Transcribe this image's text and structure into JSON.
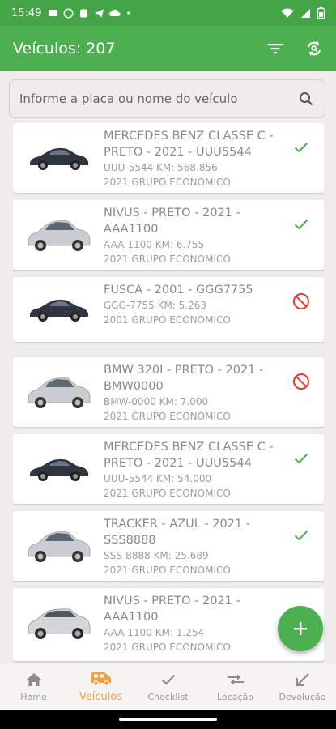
{
  "status_bar": {
    "time": "15:49",
    "dot": "•"
  },
  "header": {
    "title": "Veículos: 207"
  },
  "search": {
    "placeholder": "Informe a placa ou nome do veículo"
  },
  "colors": {
    "primary": "#4caf50",
    "accent": "#f0a040",
    "ok": "#4caf50",
    "blocked": "#e53935"
  },
  "vehicles": [
    {
      "name": "MERCEDES BENZ CLASSE C - PRETO  - 2021 - UUU5544",
      "info": "UUU-5544 KM: 568.856",
      "group": "2021 GRUPO ECONOMICO",
      "status": "check-icon",
      "image": "dark-sedan"
    },
    {
      "name": "NIVUS  - PRETO  - 2021 - AAA1100",
      "info": "AAA-1100 KM: 6.755",
      "group": "2021 GRUPO ECONOMICO",
      "status": "check-icon",
      "image": "silver-sedan"
    },
    {
      "name": "FUSCA  - 2001 - GGG7755",
      "info": "GGG-7755 KM: 5.263",
      "group": "2001 GRUPO ECONOMICO",
      "status": "blocked-icon",
      "image": "dark-sedan"
    },
    {
      "name": "BMW 320I - PRETO  - 2021 - BMW0000",
      "info": "BMW-0000 KM: 7.000",
      "group": "2021 GRUPO ECONOMICO",
      "status": "blocked-icon",
      "image": "silver-sedan"
    },
    {
      "name": "MERCEDES BENZ CLASSE C - PRETO  - 2021 - UUU5544",
      "info": "UUU-5544 KM: 54.000",
      "group": "2021 GRUPO ECONOMICO",
      "status": "check-icon",
      "image": "dark-sedan"
    },
    {
      "name": "TRACKER  - AZUL  - 2021 - SSS8888",
      "info": "SSS-8888 KM: 25.689",
      "group": "2021 GRUPO ECONOMICO",
      "status": "check-icon",
      "image": "silver-sedan"
    },
    {
      "name": "NIVUS  - PRETO  - 2021 - AAA1100",
      "info": "AAA-1100 KM: 1.254",
      "group": "2021 GRUPO ECONOMICO",
      "status": "",
      "image": "silver-suv"
    }
  ],
  "nav": [
    {
      "label": "Home",
      "icon": "home-icon"
    },
    {
      "label": "Veículos",
      "icon": "van-icon"
    },
    {
      "label": "Checklist",
      "icon": "check-icon"
    },
    {
      "label": "Locação",
      "icon": "swap-icon"
    },
    {
      "label": "Devolução",
      "icon": "return-arrow-icon"
    }
  ],
  "active_nav": 1
}
